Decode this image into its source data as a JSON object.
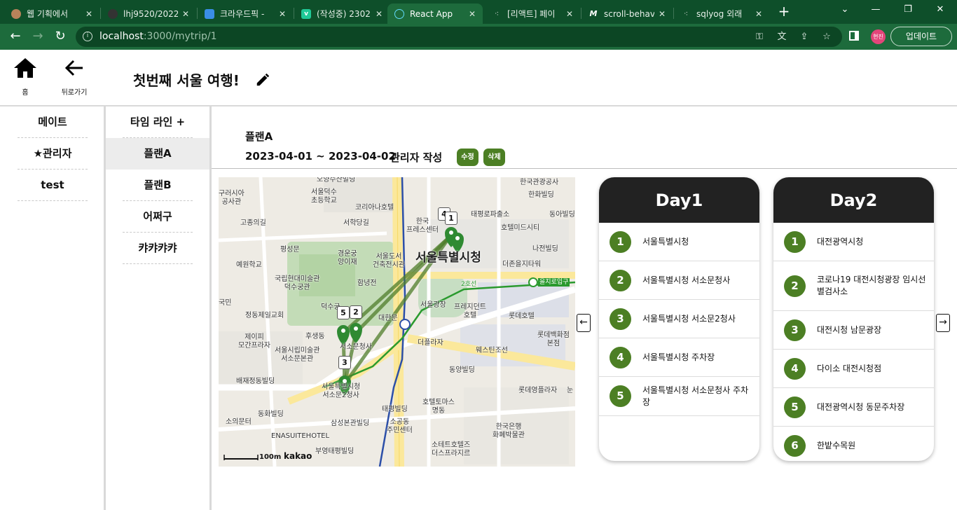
{
  "browser": {
    "tabs": [
      {
        "label": "웹 기획에서 ",
        "active": false,
        "icon": "favicon-avatar"
      },
      {
        "label": "lhj9520/2022",
        "active": false,
        "icon": "github-icon"
      },
      {
        "label": "크라우드픽 -",
        "active": false,
        "icon": "image-icon"
      },
      {
        "label": "(작성중) 2302",
        "active": false,
        "icon": "velog-icon"
      },
      {
        "label": "React App",
        "active": true,
        "icon": "react-icon"
      },
      {
        "label": "[리액트] 페이",
        "active": false,
        "icon": "tistory-icon"
      },
      {
        "label": "scroll-behavi",
        "active": false,
        "icon": "mdn-icon"
      },
      {
        "label": "sqlyog 외래",
        "active": false,
        "icon": "tistory-icon"
      }
    ],
    "url_host": "localhost",
    "url_path": ":3000/mytrip/1",
    "profile_initials": "현진",
    "update_label": "업데이트",
    "accent": "#1d6b3c"
  },
  "header": {
    "home_label": "홈",
    "back_label": "뒤로가기",
    "trip_title": "첫번째 서울 여행!"
  },
  "members": {
    "items": [
      {
        "label": "메이트"
      },
      {
        "label": "★관리자"
      },
      {
        "label": "test"
      }
    ]
  },
  "timeline": {
    "title": "타임 라인 +",
    "plans": [
      {
        "label": "플랜A",
        "active": true
      },
      {
        "label": "플랜B",
        "active": false
      },
      {
        "label": "어쩌구",
        "active": false
      },
      {
        "label": "캬캬캬캬",
        "active": false
      }
    ]
  },
  "plan": {
    "name": "플랜A",
    "dates": "2023-04-01 ~ 2023-04-02",
    "author": "관리자 작성",
    "edit_label": "수정",
    "delete_label": "삭제",
    "accent": "#4c7f24"
  },
  "map": {
    "labels": {
      "city_hall": "서울특별시청",
      "seoul_plaza": "서울광장",
      "deoksugung": "덕수궁",
      "daehanmun": "대한문",
      "seosomun": "서울특별시청\n서소문2청사",
      "annex": "서소문청사",
      "seoul_library": "서울도서\n건축전시관",
      "hotel_press": "프레지던트\n호텔",
      "lotte_hotel": "롯데호텔",
      "lotte_dept": "롯데백화점\n본점",
      "westin": "웨스틴조선",
      "plaza": "더플라자",
      "yeongil": "예원학교",
      "jeongdong": "정동제일교회",
      "gojong": "고종의길",
      "art_museum": "국립현대미술관\n덕수궁관",
      "seosomun_museum": "서울시립미술관\n서소문본관",
      "euljiro1ga": "을지로입구",
      "sogong": "소공동\n주민센터",
      "shinhan": "한국은행\n화폐박물관",
      "taepyeong": "태평빌딩",
      "samsung": "삼성본관빌딩",
      "enasuite": "ENASUITEHOTEL",
      "koreana": "코리아나호텔",
      "russia": "구러시아\n공사관",
      "tourism": "한국관광공사",
      "hanwha": "한화빌딩",
      "hotel_midcity": "호텔미드시티",
      "taepyeongro": "태평로파출소",
      "najeon": "나전빌딩",
      "seohakdang": "서학당길",
      "gyeongungung": "경운궁\n양이재",
      "hamnyeongjeon": "함녕전",
      "pyeongseongmun": "평성문",
      "jepi": "제이피\n모간프라자",
      "baejae": "배재정동빌딩",
      "sowimun": "소의문터",
      "donghwa": "동화빌딩",
      "buyoung": "부영태평빌딩",
      "dongyang": "동양빌딩",
      "hotel_tomas": "호텔토마스\n명동",
      "sotete": "소테트호텔즈\n더스프라지르",
      "lotte_young": "롯데영플라자",
      "deojone": "더존을지타워",
      "hanguk_press": "한국\n프레스센터",
      "seoul_deoksu": "서울덕수\n초등학교",
      "osyang": "오양수산빌딩",
      "lotte_plaza_n": "눈",
      "kookmin": "국민",
      "dongah": "동아빌딩",
      "hushe": "후생동",
      "line2": "2호선",
      "scale": "100m",
      "brand": "kakao"
    },
    "markers": [
      "4",
      "1",
      "5",
      "2",
      "3"
    ]
  },
  "days": [
    {
      "title": "Day1",
      "places": [
        {
          "no": "1",
          "name": "서울특별시청"
        },
        {
          "no": "2",
          "name": "서울특별시청 서소문청사"
        },
        {
          "no": "3",
          "name": "서울특별시청 서소문2청사"
        },
        {
          "no": "4",
          "name": "서울특별시청 주차장"
        },
        {
          "no": "5",
          "name": "서울특별시청 서소문청사 주차장"
        }
      ]
    },
    {
      "title": "Day2",
      "places": [
        {
          "no": "1",
          "name": "대전광역시청"
        },
        {
          "no": "2",
          "name": "코로나19 대전시청광장 임시선별검사소"
        },
        {
          "no": "3",
          "name": "대전시청 남문광장"
        },
        {
          "no": "4",
          "name": "다이소 대전시청점"
        },
        {
          "no": "5",
          "name": "대전광역시청 동문주차장"
        },
        {
          "no": "6",
          "name": "한밭수목원"
        }
      ]
    }
  ],
  "nav": {
    "prev_icon": "arrow-left-icon",
    "next_icon": "arrow-right-icon"
  }
}
